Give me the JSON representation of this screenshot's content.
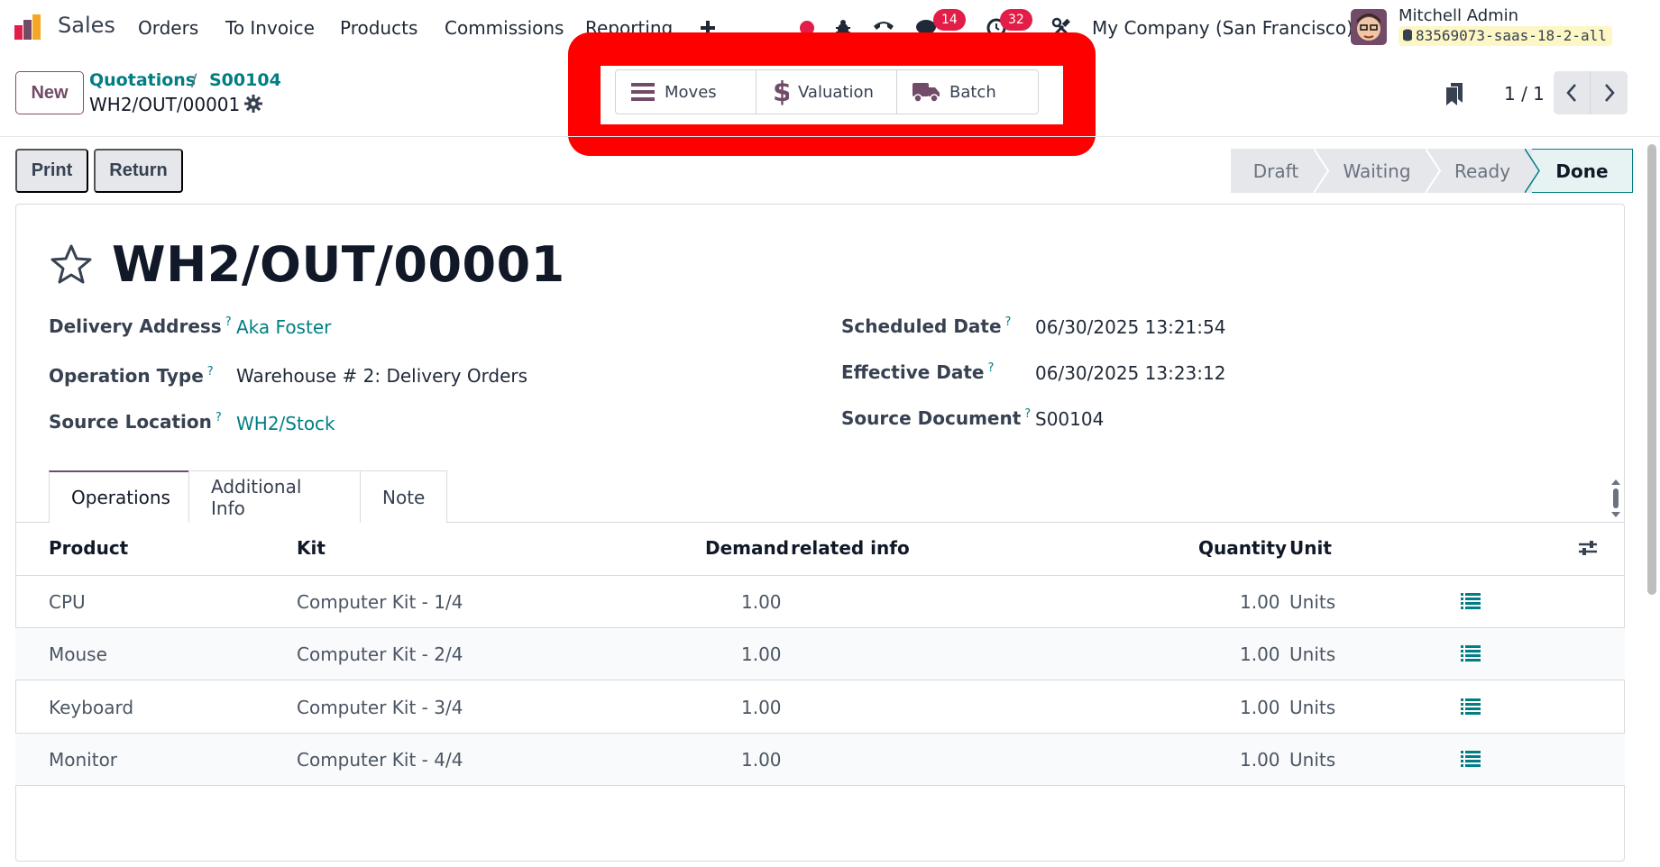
{
  "navbar": {
    "app_name": "Sales",
    "menus": [
      "Orders",
      "To Invoice",
      "Products",
      "Commissions",
      "Reporting"
    ],
    "messages_badge": "14",
    "activities_badge": "32",
    "company": "My Company (San Francisco)",
    "user_name": "Mitchell Admin",
    "database": "83569073-saas-18-2-all"
  },
  "control": {
    "new_label": "New",
    "breadcrumb": [
      "Quotations",
      "S00104"
    ],
    "breadcrumb_sep": "/",
    "record_name": "WH2/OUT/00001",
    "smart_buttons": [
      "Moves",
      "Valuation",
      "Batch"
    ],
    "pager": "1 / 1"
  },
  "actions": {
    "print": "Print",
    "return": "Return"
  },
  "status": {
    "steps": [
      "Draft",
      "Waiting",
      "Ready",
      "Done"
    ],
    "current": "Done"
  },
  "form": {
    "title": "WH2/OUT/00001",
    "left_fields": [
      {
        "label": "Delivery Address",
        "value": "Aka Foster"
      },
      {
        "label": "Operation Type",
        "value": "Warehouse # 2: Delivery Orders"
      },
      {
        "label": "Source Location",
        "value": "WH2/Stock"
      }
    ],
    "right_fields": [
      {
        "label": "Scheduled Date",
        "value": "06/30/2025 13:21:54"
      },
      {
        "label": "Effective Date",
        "value": "06/30/2025 13:23:12"
      },
      {
        "label": "Source Document",
        "value": "S00104"
      }
    ],
    "help_mark": "?"
  },
  "tabs": [
    "Operations",
    "Additional Info",
    "Note"
  ],
  "table": {
    "headers": [
      "Product",
      "Kit",
      "Demand",
      "related info",
      "Quantity",
      "Unit"
    ],
    "rows": [
      {
        "product": "CPU",
        "kit": "Computer Kit - 1/4",
        "demand": "1.00",
        "quantity": "1.00",
        "unit": "Units"
      },
      {
        "product": "Mouse",
        "kit": "Computer Kit - 2/4",
        "demand": "1.00",
        "quantity": "1.00",
        "unit": "Units"
      },
      {
        "product": "Keyboard",
        "kit": "Computer Kit - 3/4",
        "demand": "1.00",
        "quantity": "1.00",
        "unit": "Units"
      },
      {
        "product": "Monitor",
        "kit": "Computer Kit - 4/4",
        "demand": "1.00",
        "quantity": "1.00",
        "unit": "Units"
      }
    ]
  },
  "colors": {
    "brand": "#714b67",
    "link": "#017e84",
    "badge": "#e11d48",
    "highlight": "#ff0000"
  }
}
